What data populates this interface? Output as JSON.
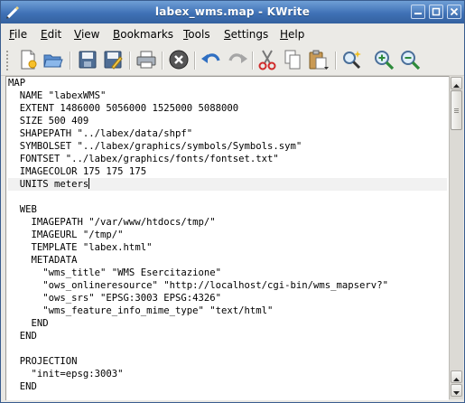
{
  "window": {
    "title": "labex_wms.map - KWrite"
  },
  "menubar": {
    "items": [
      {
        "label": "File",
        "accel": "F",
        "rest": "ile"
      },
      {
        "label": "Edit",
        "accel": "E",
        "rest": "dit"
      },
      {
        "label": "View",
        "accel": "V",
        "rest": "iew"
      },
      {
        "label": "Bookmarks",
        "accel": "B",
        "rest": "ookmarks"
      },
      {
        "label": "Tools",
        "accel": "T",
        "rest": "ools"
      },
      {
        "label": "Settings",
        "accel": "S",
        "rest": "ettings"
      },
      {
        "label": "Help",
        "accel": "H",
        "rest": "elp"
      }
    ]
  },
  "toolbar": {
    "icons": [
      "new-document-icon",
      "open-folder-icon",
      "save-icon",
      "save-as-icon",
      "print-icon",
      "close-document-icon",
      "undo-icon",
      "redo-icon",
      "cut-icon",
      "copy-icon",
      "paste-icon",
      "find-icon",
      "zoom-in-icon",
      "zoom-out-icon"
    ]
  },
  "editor": {
    "current_line": 8,
    "lines": [
      "MAP",
      "  NAME \"labexWMS\"",
      "  EXTENT 1486000 5056000 1525000 5088000",
      "  SIZE 500 409",
      "  SHAPEPATH \"../labex/data/shpf\"",
      "  SYMBOLSET \"../labex/graphics/symbols/Symbols.sym\"",
      "  FONTSET \"../labex/graphics/fonts/fontset.txt\"",
      "  IMAGECOLOR 175 175 175",
      "  UNITS meters",
      "",
      "  WEB",
      "    IMAGEPATH \"/var/www/htdocs/tmp/\"",
      "    IMAGEURL \"/tmp/\"",
      "    TEMPLATE \"labex.html\"",
      "    METADATA",
      "      \"wms_title\" \"WMS Esercitazione\"",
      "      \"ows_onlineresource\" \"http://localhost/cgi-bin/wms_mapserv?\"",
      "      \"ows_srs\" \"EPSG:3003 EPSG:4326\"",
      "      \"wms_feature_info_mime_type\" \"text/html\"",
      "    END",
      "  END",
      "",
      "  PROJECTION",
      "    \"init=epsg:3003\"",
      "  END"
    ]
  },
  "colors": {
    "titlebar": "#3f71b6",
    "current_line": "#f1f1f1"
  }
}
